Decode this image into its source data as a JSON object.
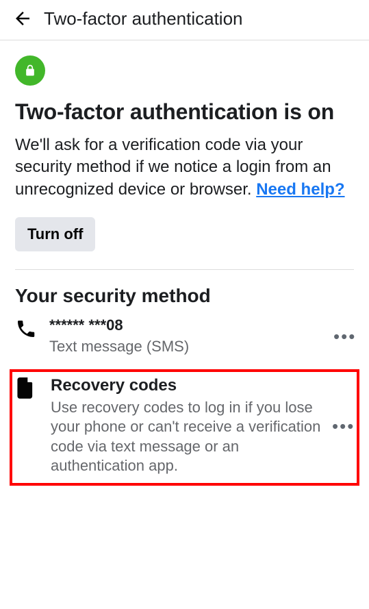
{
  "header": {
    "title": "Two-factor authentication"
  },
  "main": {
    "heading": "Two-factor authentication is on",
    "description": "We'll ask for a verification code via your security method if we notice a login from an unrecognized device or browser. ",
    "help_link": "Need help?",
    "turn_off_label": "Turn off"
  },
  "methods": {
    "section_title": "Your security method",
    "phone": {
      "title": "****** ***08",
      "subtitle": "Text message (SMS)"
    },
    "recovery": {
      "title": "Recovery codes",
      "subtitle": "Use recovery codes to log in if you lose your phone or can't receive a verification code via text message or an authentication app."
    }
  }
}
